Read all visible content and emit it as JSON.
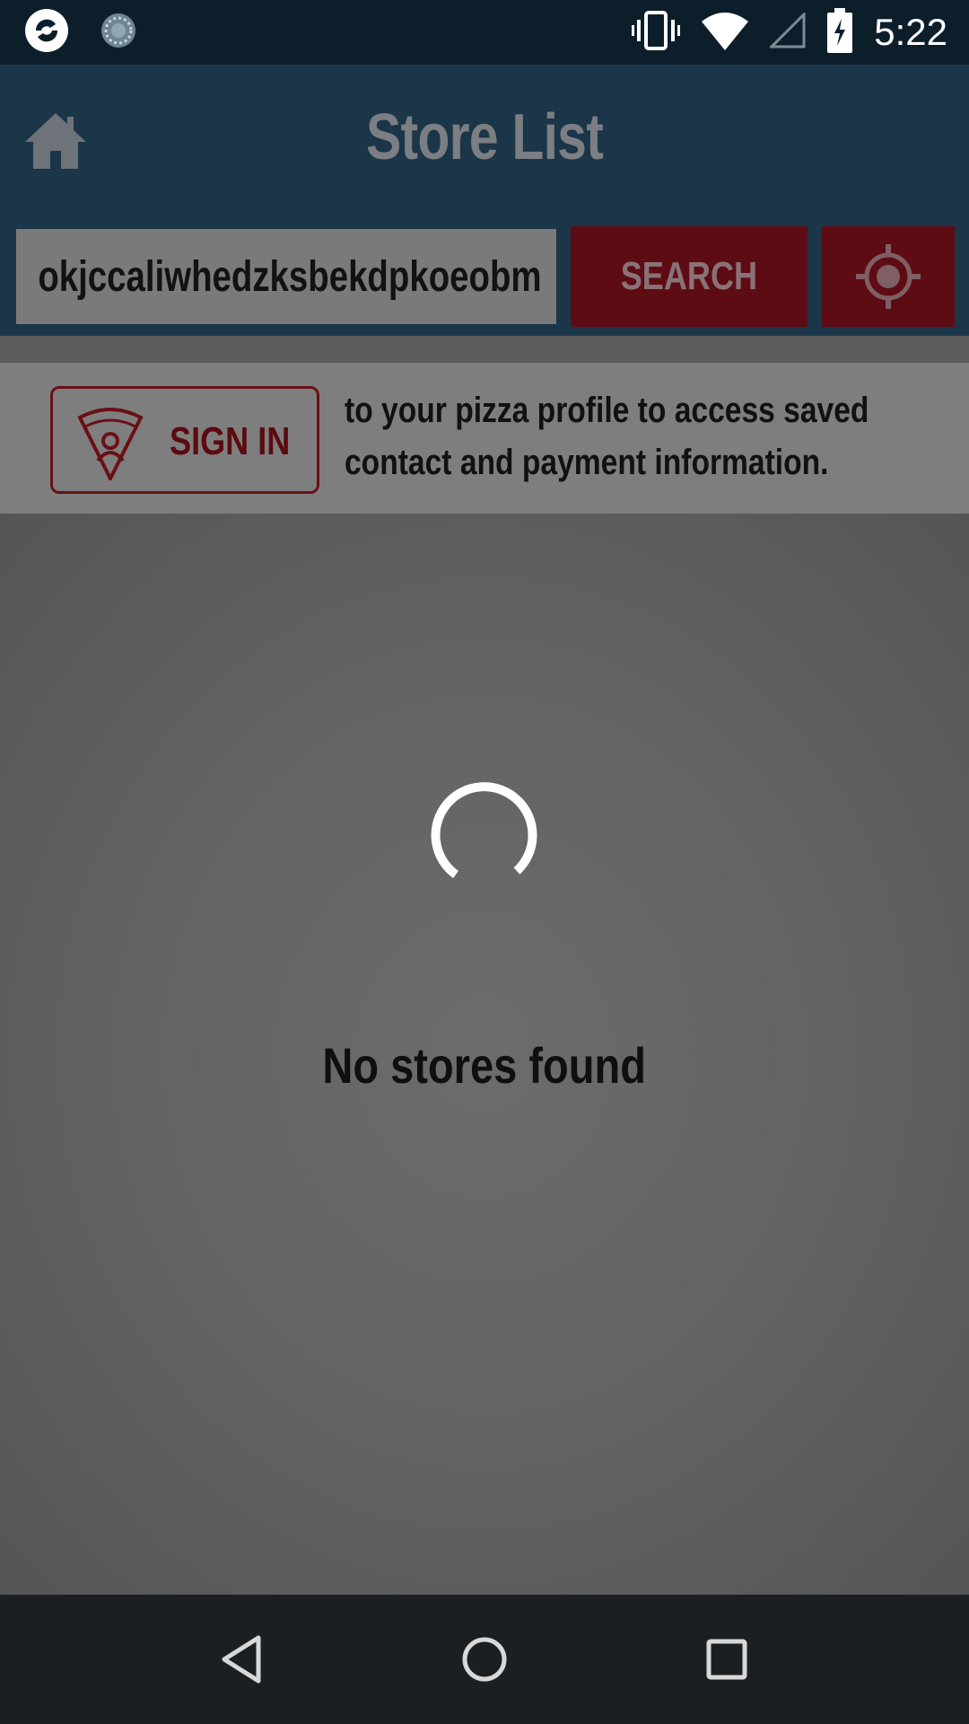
{
  "status_bar": {
    "time": "5:22",
    "icons": [
      "app-logo-icon",
      "sync-icon",
      "vibrate-icon",
      "wifi-icon",
      "cell-signal-icon",
      "battery-charging-icon"
    ]
  },
  "header": {
    "title": "Store List",
    "home_icon": "home-icon",
    "search": {
      "value": "okjccaliwhedzksbekdpkoeobm",
      "button_label": "SEARCH",
      "locate_icon": "crosshair-icon"
    }
  },
  "signin_banner": {
    "button_label": "SIGN IN",
    "button_icon": "pizza-profile-icon",
    "text": "to your pizza profile to access saved contact and payment information."
  },
  "content": {
    "loading": true,
    "empty_message": "No stores found"
  },
  "nav_bar": {
    "buttons": [
      "back-icon",
      "home-circle-icon",
      "recents-icon"
    ]
  },
  "colors": {
    "status_bar": "#0d1e2b",
    "header": "#1b3549",
    "accent_red": "#5e0c14",
    "overlay_gray": "#646464",
    "nav_bar": "#1c1f21"
  }
}
